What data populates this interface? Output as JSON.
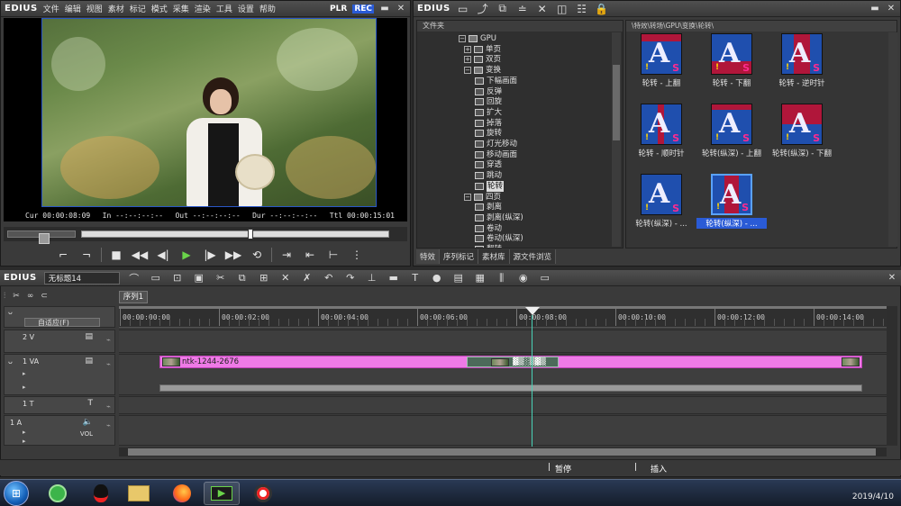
{
  "player": {
    "logo": "EDIUS",
    "menu": [
      "文件",
      "编辑",
      "视图",
      "素材",
      "标记",
      "模式",
      "采集",
      "渲染",
      "工具",
      "设置",
      "帮助"
    ],
    "plr": "PLR",
    "rec": "REC",
    "timecodes": {
      "cur": "Cur 00:00:08:09",
      "in": "In --:--:--:--",
      "out": "Out --:--:--:--",
      "dur": "Dur --:--:--:--",
      "ttl": "Ttl 00:00:15:01"
    },
    "scrub_position": 0.55
  },
  "bin": {
    "logo": "EDIUS",
    "folder_header": "文件夹",
    "tree": [
      {
        "label": "GPU",
        "depth": 0,
        "expander": "−",
        "open": true
      },
      {
        "label": "单页",
        "depth": 1,
        "expander": "+",
        "open": false
      },
      {
        "label": "双页",
        "depth": 1,
        "expander": "+",
        "open": false
      },
      {
        "label": "变换",
        "depth": 1,
        "expander": "−",
        "open": true
      },
      {
        "label": "下幅画面",
        "depth": 2
      },
      {
        "label": "反弹",
        "depth": 2
      },
      {
        "label": "回旋",
        "depth": 2
      },
      {
        "label": "扩大",
        "depth": 2
      },
      {
        "label": "掉落",
        "depth": 2
      },
      {
        "label": "旋转",
        "depth": 2
      },
      {
        "label": "灯光移动",
        "depth": 2
      },
      {
        "label": "移动画面",
        "depth": 2
      },
      {
        "label": "穿透",
        "depth": 2
      },
      {
        "label": "跳动",
        "depth": 2
      },
      {
        "label": "轮转",
        "depth": 2,
        "selected": true
      },
      {
        "label": "四页",
        "depth": 1,
        "expander": "−",
        "open": true
      },
      {
        "label": "剥离",
        "depth": 2
      },
      {
        "label": "剥离(纵深)",
        "depth": 2
      },
      {
        "label": "卷动",
        "depth": 2
      },
      {
        "label": "卷动(纵深)",
        "depth": 2
      },
      {
        "label": "翻转",
        "depth": 2
      }
    ],
    "tabs": [
      "特效",
      "序列标记",
      "素材库",
      "源文件浏览"
    ],
    "path": "\\特效\\转场\\GPU\\变换\\轮转\\",
    "effects": [
      {
        "label": "轮转 - 上翻",
        "selected": false
      },
      {
        "label": "轮转 - 下翻",
        "selected": false
      },
      {
        "label": "轮转 - 逆时针",
        "selected": false
      },
      {
        "label": "轮转 - 顺时针",
        "selected": false
      },
      {
        "label": "轮转(纵深) - 上翻",
        "selected": false
      },
      {
        "label": "轮转(纵深) - 下翻",
        "selected": false
      },
      {
        "label": "轮转(纵深) - ...",
        "selected": false
      },
      {
        "label": "轮转(纵深) - ...",
        "selected": true
      }
    ]
  },
  "timeline": {
    "logo": "EDIUS",
    "project": "无标题14",
    "sequence_tab": "序列1",
    "adaptive": "自适应(F)",
    "ruler": [
      "00:00:00:00",
      "00:00:02:00",
      "00:00:04:00",
      "00:00:06:00",
      "00:00:08:00",
      "00:00:10:00",
      "00:00:12:00",
      "00:00:14:00"
    ],
    "tracks": {
      "v2": "2 V",
      "va1": "1 VA",
      "t1": "1 T",
      "a1": "1 A",
      "vol": "VOL"
    },
    "clip_name": "ntk-1244-2676",
    "status": {
      "pause": "暂停",
      "insert": "插入"
    }
  },
  "taskbar": {
    "clock": "2019/4/10"
  }
}
